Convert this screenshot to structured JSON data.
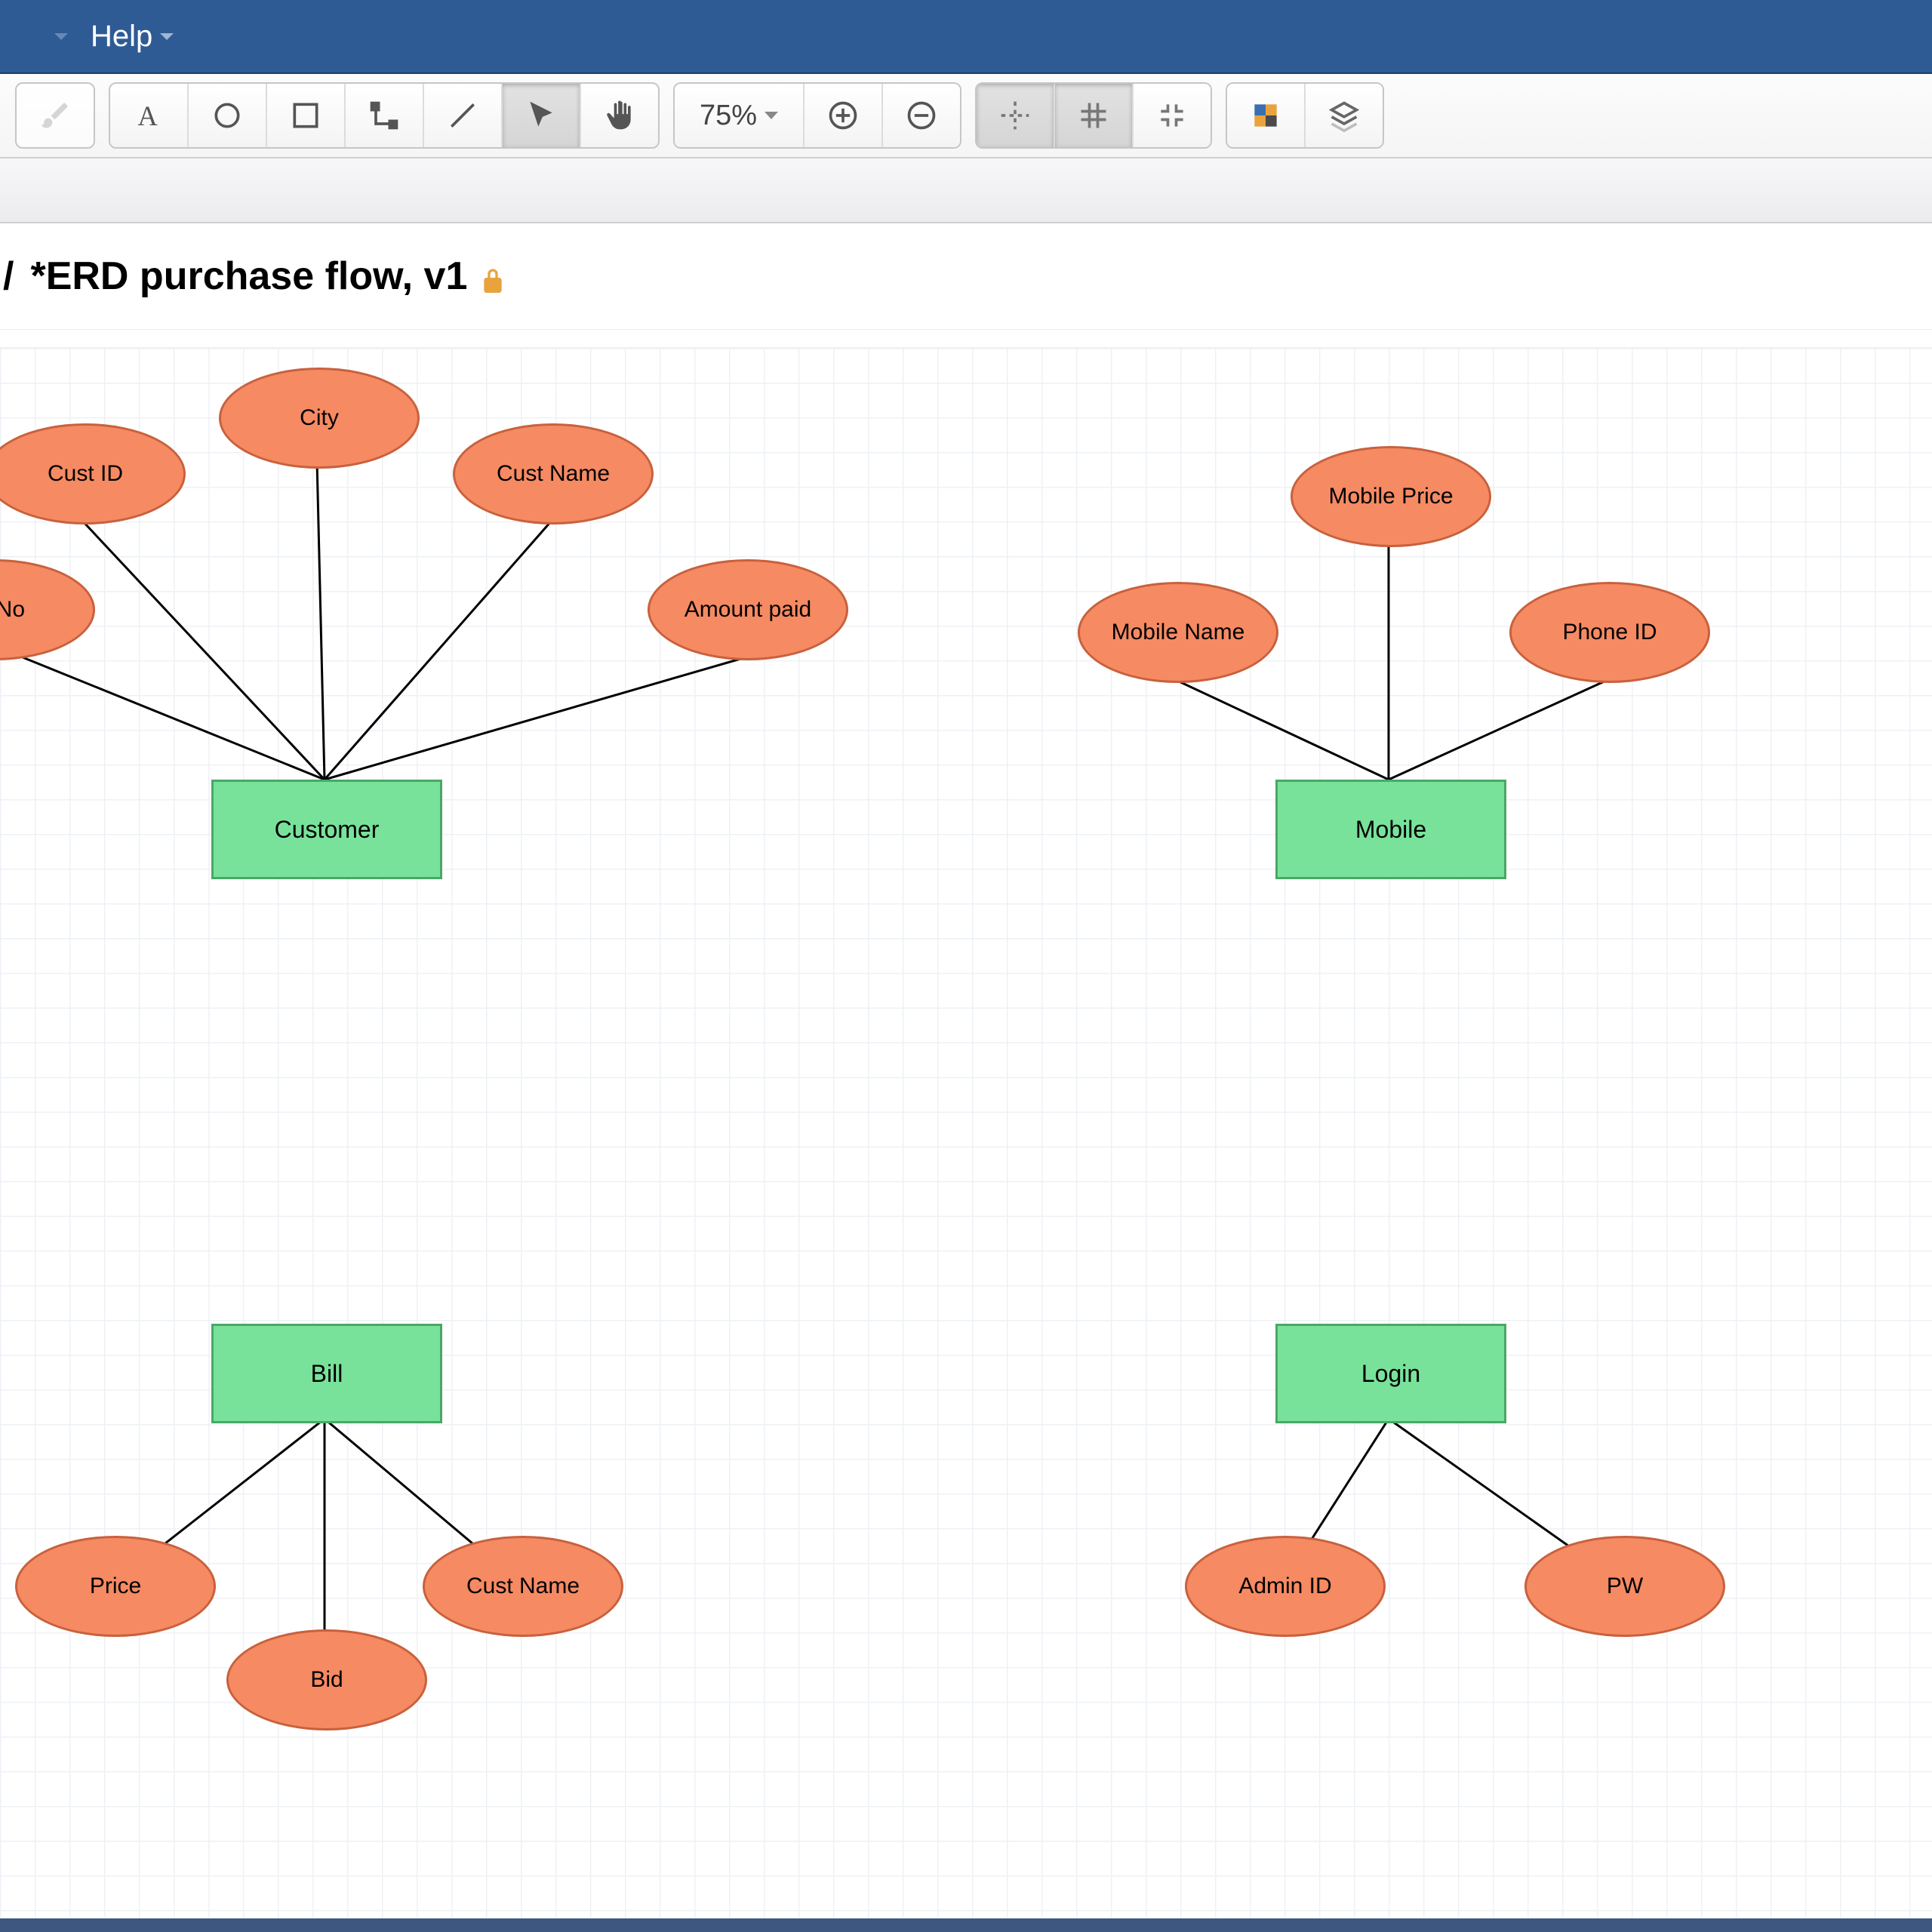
{
  "menu": {
    "help": "Help"
  },
  "toolbar": {
    "zoom_label": "75%"
  },
  "title": {
    "prefix": "/",
    "name": "*ERD purchase flow, v1"
  },
  "diagram": {
    "entities": {
      "customer": "Customer",
      "mobile": "Mobile",
      "bill": "Bill",
      "login": "Login"
    },
    "attributes": {
      "cust_id": "Cust ID",
      "city": "City",
      "cust_name": "Cust Name",
      "phone_no": "ne No",
      "amount_paid": "Amount paid",
      "mobile_price": "Mobile Price",
      "mobile_name": "Mobile Name",
      "phone_id": "Phone ID",
      "bill_price": "Price",
      "bill_cname": "Cust Name",
      "bid": "Bid",
      "admin_id": "Admin ID",
      "pw": "PW"
    }
  }
}
